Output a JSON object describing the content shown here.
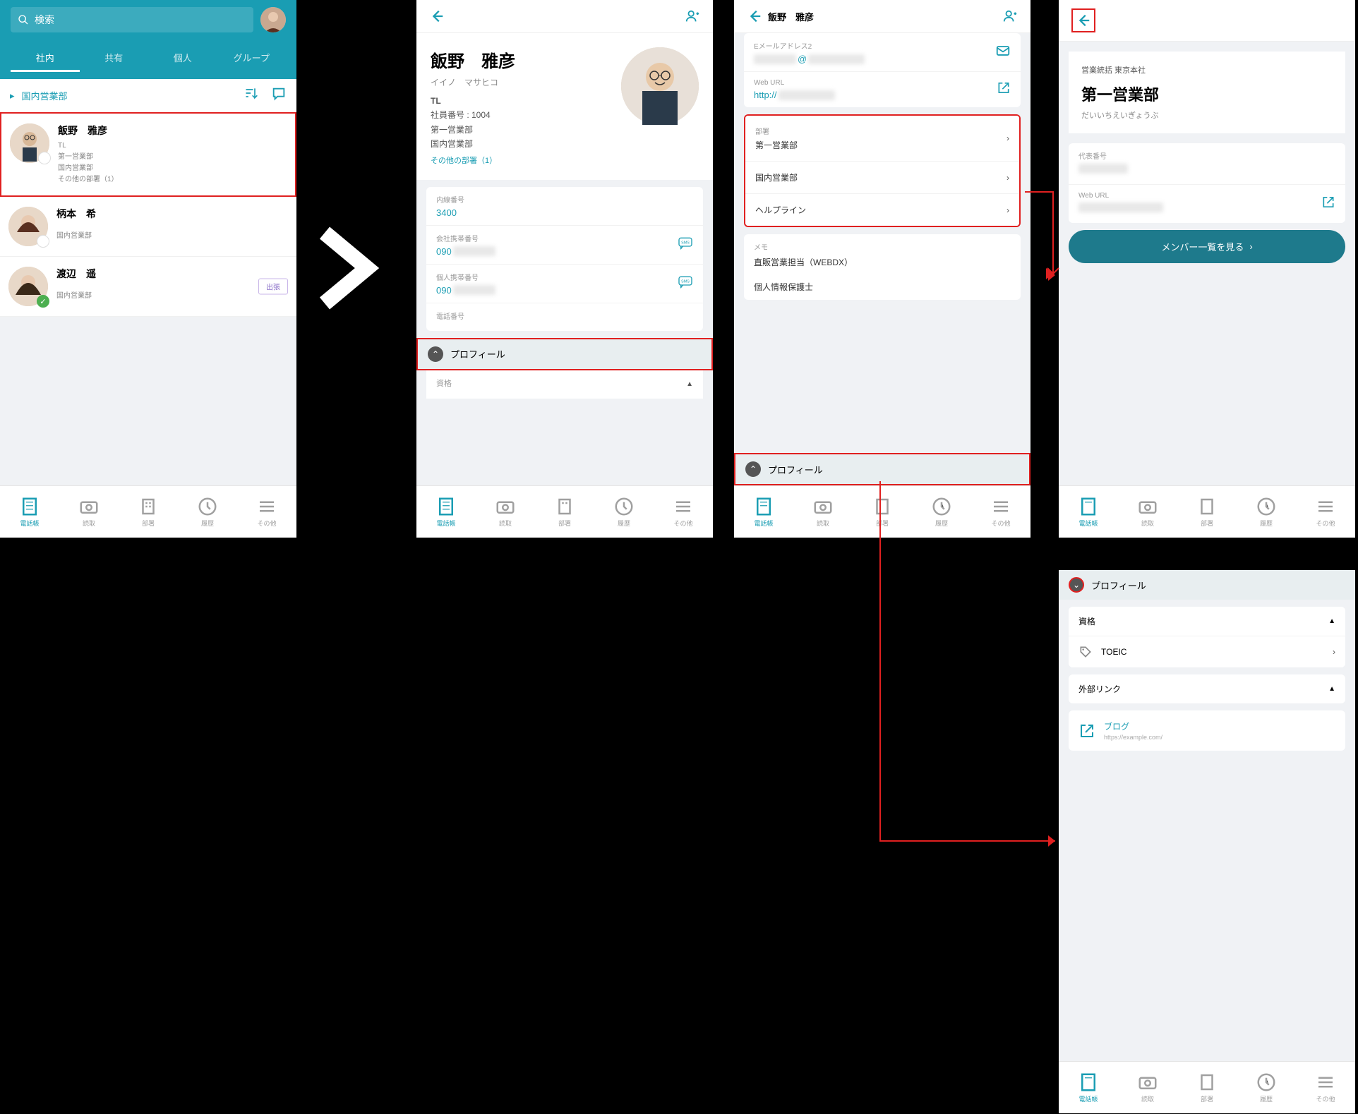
{
  "s1": {
    "search_placeholder": "検索",
    "tabs": {
      "t1": "社内",
      "t2": "共有",
      "t3": "個人",
      "t4": "グループ"
    },
    "breadcrumb": "国内営業部",
    "people": {
      "p1": {
        "name": "飯野　雅彦",
        "role": "TL",
        "dept1": "第一営業部",
        "dept2": "国内営業部",
        "extra": "その他の部署（1）"
      },
      "p2": {
        "name": "柄本　希",
        "role": "",
        "dept": "国内営業部"
      },
      "p3": {
        "name": "渡辺　遥",
        "role": "",
        "dept": "国内営業部",
        "badge": "出張"
      }
    }
  },
  "s2": {
    "name": "飯野　雅彦",
    "kana": "イイノ　マサヒコ",
    "role": "TL",
    "emp_num": "社員番号 : 1004",
    "dept1": "第一営業部",
    "dept2": "国内営業部",
    "extra": "その他の部署（1）",
    "fields": {
      "ext_label": "内線番号",
      "ext_val": "3400",
      "work_mobile_label": "会社携帯番号",
      "work_mobile_prefix": "090",
      "pers_mobile_label": "個人携帯番号",
      "pers_mobile_prefix": "090",
      "phone_label": "電話番号"
    },
    "profile_section": "プロフィール",
    "qual_label": "資格"
  },
  "s3": {
    "name": "飯野　雅彦",
    "email2_label": "Eメールアドレス2",
    "email2_prefix": "@",
    "weburl_label": "Web URL",
    "weburl_prefix": "http://",
    "dept_label": "部署",
    "dept1": "第一営業部",
    "dept2": "国内営業部",
    "helpline": "ヘルプライン",
    "memo_label": "メモ",
    "memo1": "直販営業担当（WEBDX）",
    "memo2": "個人情報保護士",
    "profile_section": "プロフィール"
  },
  "s4": {
    "breadcrumb": "営業統括 東京本社",
    "dept_title": "第一営業部",
    "dept_reading": "だいいちえいぎょうぶ",
    "repnum_label": "代表番号",
    "weburl_label": "Web URL",
    "btn": "メンバー一覧を見る"
  },
  "s5": {
    "profile_section": "プロフィール",
    "qual_label": "資格",
    "qual_item": "TOEIC",
    "ext_links_label": "外部リンク",
    "ext_title": "ブログ",
    "ext_url": "https://example.com/"
  },
  "nav": {
    "n1": "電話帳",
    "n2": "読取",
    "n3": "部署",
    "n4": "履歴",
    "n5": "その他"
  }
}
